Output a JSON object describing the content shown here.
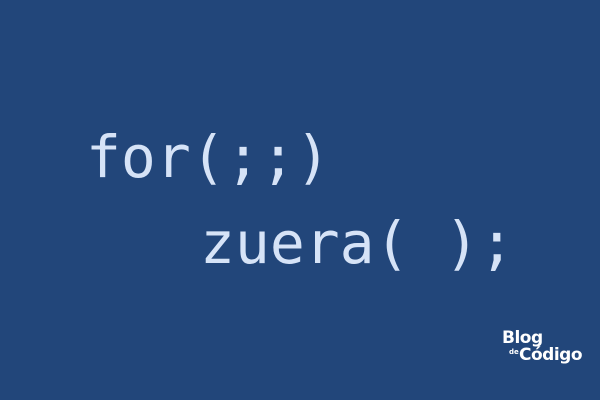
{
  "code": {
    "line1": "for(;;)",
    "line2": "zuera( );"
  },
  "logo": {
    "blog": "Blog",
    "de": "de",
    "codigo": "Código"
  },
  "colors": {
    "background": "#22467a",
    "code_text": "#d6e3f7",
    "logo_text": "#ffffff"
  }
}
